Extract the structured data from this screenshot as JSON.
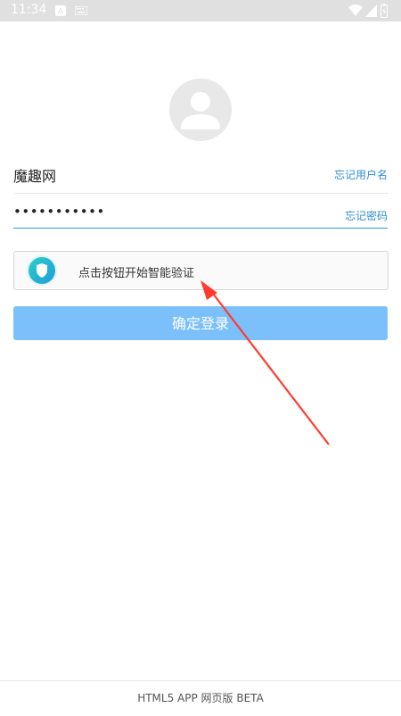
{
  "status_bar": {
    "time": "11:34",
    "icons": [
      "a-icon",
      "keyboard-icon",
      "wifi-icon",
      "signal-icon",
      "battery-icon"
    ]
  },
  "avatar": {
    "icon": "user-avatar-icon"
  },
  "login_form": {
    "username_value": "魔趣网",
    "forgot_username_link": "忘记用户名",
    "password_value": "•••••••••••",
    "forgot_password_link": "忘记密码",
    "captcha_prompt": "点击按钮开始智能验证",
    "captcha_icon": "shield-icon",
    "submit_label": "确定登录"
  },
  "footer": {
    "text": "HTML5 APP 网页版 BETA"
  },
  "colors": {
    "link": "#2d8fd6",
    "button": "#7bc0fb",
    "arrow": "#ff3b30"
  }
}
